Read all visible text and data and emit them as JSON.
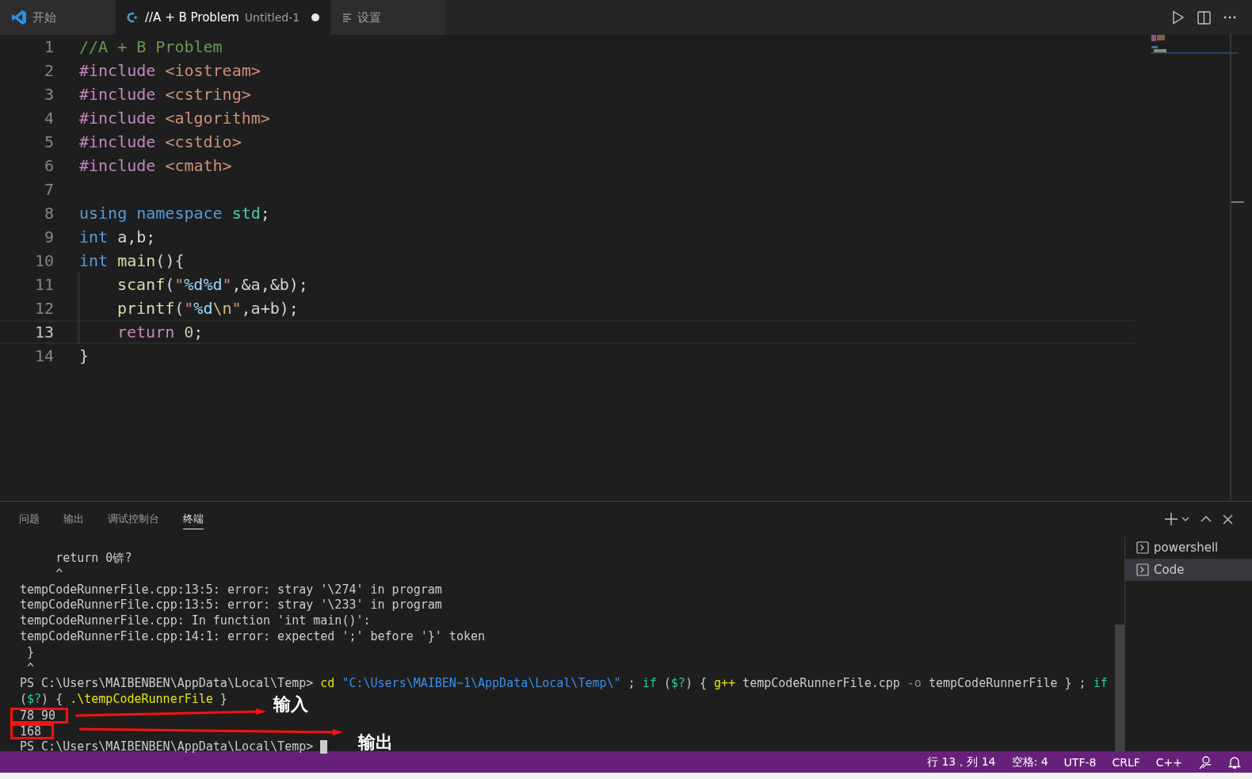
{
  "tabs": [
    {
      "kind": "welcome",
      "label": "开始",
      "selected": false
    },
    {
      "kind": "cpp",
      "label": "//A + B Problem",
      "description": "Untitled-1",
      "dirty": true,
      "selected": true
    },
    {
      "kind": "settings",
      "label": "设置",
      "selected": false
    }
  ],
  "editor": {
    "lines": [
      {
        "number": "1",
        "current": false,
        "tokens": [
          {
            "kind": "comment",
            "text": "//A + B Problem"
          }
        ]
      },
      {
        "number": "2",
        "current": false,
        "tokens": [
          {
            "kind": "directive",
            "text": "#include "
          },
          {
            "kind": "string",
            "text": "<iostream>"
          }
        ]
      },
      {
        "number": "3",
        "current": false,
        "tokens": [
          {
            "kind": "directive",
            "text": "#include "
          },
          {
            "kind": "string",
            "text": "<cstring>"
          }
        ]
      },
      {
        "number": "4",
        "current": false,
        "tokens": [
          {
            "kind": "directive",
            "text": "#include "
          },
          {
            "kind": "string",
            "text": "<algorithm>"
          }
        ]
      },
      {
        "number": "5",
        "current": false,
        "tokens": [
          {
            "kind": "directive",
            "text": "#include "
          },
          {
            "kind": "string",
            "text": "<cstdio>"
          }
        ]
      },
      {
        "number": "6",
        "current": false,
        "tokens": [
          {
            "kind": "directive",
            "text": "#include "
          },
          {
            "kind": "string",
            "text": "<cmath>"
          }
        ]
      },
      {
        "number": "7",
        "current": false
      },
      {
        "number": "8",
        "current": false,
        "tokens": [
          {
            "kind": "keyword",
            "text": "using "
          },
          {
            "kind": "keyword",
            "text": "namespace "
          },
          {
            "kind": "type",
            "text": "std"
          },
          {
            "kind": "plain",
            "text": ";"
          }
        ]
      },
      {
        "number": "9",
        "current": false,
        "tokens": [
          {
            "kind": "keyword",
            "text": "int "
          },
          {
            "kind": "plain",
            "text": "a,b;"
          }
        ]
      },
      {
        "number": "10",
        "current": false,
        "tokens": [
          {
            "kind": "keyword",
            "text": "int "
          },
          {
            "kind": "function",
            "text": "main"
          },
          {
            "kind": "plain",
            "text": "(){"
          }
        ]
      },
      {
        "number": "11",
        "current": false,
        "indented": true,
        "tokens": [
          {
            "kind": "function",
            "text": "scanf"
          },
          {
            "kind": "plain",
            "text": "("
          },
          {
            "kind": "string",
            "text": "\""
          },
          {
            "kind": "format",
            "text": "%d%d"
          },
          {
            "kind": "string",
            "text": "\""
          },
          {
            "kind": "plain",
            "text": ",&a,&b);"
          }
        ]
      },
      {
        "number": "12",
        "current": false,
        "indented": true,
        "tokens": [
          {
            "kind": "function",
            "text": "printf"
          },
          {
            "kind": "plain",
            "text": "("
          },
          {
            "kind": "string",
            "text": "\""
          },
          {
            "kind": "format",
            "text": "%d"
          },
          {
            "kind": "escape",
            "text": "\\n"
          },
          {
            "kind": "string",
            "text": "\""
          },
          {
            "kind": "plain",
            "text": ",a+b);"
          }
        ]
      },
      {
        "number": "13",
        "current": true,
        "indented": true,
        "tokens": [
          {
            "kind": "control",
            "text": "return "
          },
          {
            "kind": "number",
            "text": "0"
          },
          {
            "kind": "plain",
            "text": ";"
          }
        ]
      },
      {
        "number": "14",
        "current": false,
        "tokens": [
          {
            "kind": "plain",
            "text": "}"
          }
        ]
      }
    ]
  },
  "panel": {
    "tabs": [
      {
        "label": "问题",
        "selected": false
      },
      {
        "label": "输出",
        "selected": false
      },
      {
        "label": "调试控制台",
        "selected": false
      },
      {
        "label": "终端",
        "selected": true
      }
    ],
    "terminal_lines": [
      {
        "highlighted": false,
        "segments": [
          {
            "kind": "plain",
            "text": "     return 0锛?"
          }
        ]
      },
      {
        "highlighted": false,
        "segments": [
          {
            "kind": "plain",
            "text": "     ^"
          }
        ]
      },
      {
        "highlighted": false,
        "segments": [
          {
            "kind": "plain",
            "text": "tempCodeRunnerFile.cpp:13:5: error: stray '\\274' in program"
          }
        ]
      },
      {
        "highlighted": false,
        "segments": [
          {
            "kind": "plain",
            "text": "tempCodeRunnerFile.cpp:13:5: error: stray '\\233' in program"
          }
        ]
      },
      {
        "highlighted": false,
        "segments": [
          {
            "kind": "plain",
            "text": "tempCodeRunnerFile.cpp: In function 'int main()':"
          }
        ]
      },
      {
        "highlighted": false,
        "segments": [
          {
            "kind": "plain",
            "text": "tempCodeRunnerFile.cpp:14:1: error: expected ';' before '}' token"
          }
        ]
      },
      {
        "highlighted": false,
        "segments": [
          {
            "kind": "plain",
            "text": " }"
          }
        ]
      },
      {
        "highlighted": false,
        "segments": [
          {
            "kind": "plain",
            "text": " ^"
          }
        ]
      },
      {
        "highlighted": false,
        "segments": [
          {
            "kind": "plain",
            "text": "PS C:\\Users\\MAIBENBEN\\AppData\\Local\\Temp> "
          },
          {
            "kind": "command",
            "text": "cd"
          },
          {
            "kind": "string",
            "text": " \"C:\\Users\\MAIBEN~1\\AppData\\Local\\Temp\\\""
          },
          {
            "kind": "plain",
            "text": " ; "
          },
          {
            "kind": "keyword",
            "text": "if"
          },
          {
            "kind": "plain",
            "text": " ("
          },
          {
            "kind": "keyword",
            "text": "$?"
          },
          {
            "kind": "plain",
            "text": ") { "
          },
          {
            "kind": "command",
            "text": "g++"
          },
          {
            "kind": "plain",
            "text": " tempCodeRunnerFile.cpp "
          },
          {
            "kind": "dim",
            "text": "-o"
          },
          {
            "kind": "plain",
            "text": " tempCodeRunnerFile } ; "
          },
          {
            "kind": "keyword",
            "text": "if"
          }
        ]
      },
      {
        "highlighted": false,
        "segments": [
          {
            "kind": "plain",
            "text": "("
          },
          {
            "kind": "keyword",
            "text": "$?"
          },
          {
            "kind": "plain",
            "text": ") { "
          },
          {
            "kind": "command",
            "text": ".\\tempCodeRunnerFile"
          },
          {
            "kind": "plain",
            "text": " }"
          }
        ]
      },
      {
        "highlighted": true,
        "annotation": "输入",
        "segments": [
          {
            "kind": "plain",
            "text": "78 90"
          }
        ]
      },
      {
        "highlighted": true,
        "annotation": "输出",
        "segments": [
          {
            "kind": "plain",
            "text": "168"
          }
        ]
      },
      {
        "highlighted": false,
        "cursor": true,
        "segments": [
          {
            "kind": "plain",
            "text": "PS C:\\Users\\MAIBENBEN\\AppData\\Local\\Temp> "
          }
        ]
      }
    ],
    "terminals": [
      {
        "label": "powershell",
        "selected": false
      },
      {
        "label": "Code",
        "selected": true
      }
    ]
  },
  "status_bar": {
    "items": [
      "行 13，列 14",
      "空格: 4",
      "UTF-8",
      "CRLF",
      "C++"
    ]
  }
}
